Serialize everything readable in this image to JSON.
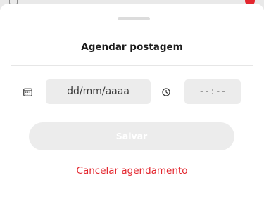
{
  "sheet": {
    "title": "Agendar postagem",
    "date_field": {
      "value": "dd/mm/aaaa",
      "icon": "calendar-icon"
    },
    "time_field": {
      "value": "--:--",
      "icon": "clock-icon"
    },
    "save_label": "Salvar",
    "cancel_label": "Cancelar agendamento"
  },
  "colors": {
    "accent_red": "#e3262e",
    "field_bg": "#ececec",
    "title_text": "#1d1d1d",
    "disabled_button_bg": "#ececec"
  }
}
